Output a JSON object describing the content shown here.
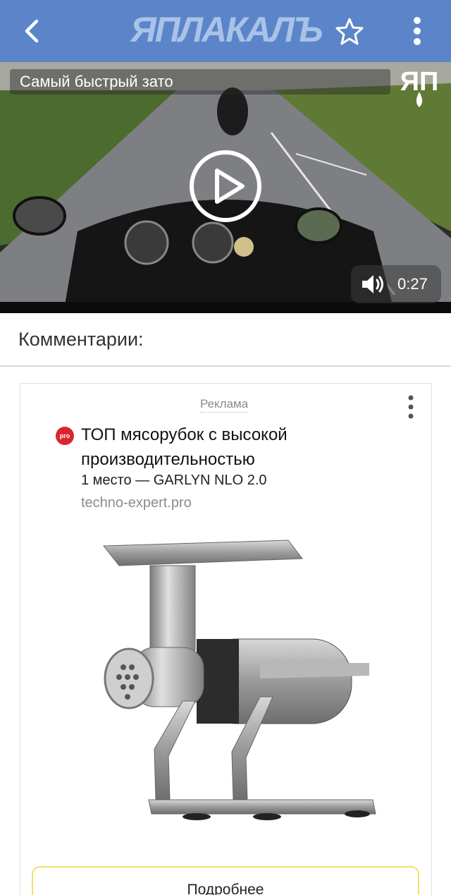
{
  "header": {
    "logo_text": "ЯПЛАКАЛЪ",
    "back_icon": "back-arrow-icon",
    "star_icon": "star-outline-icon",
    "more_icon": "more-vertical-icon",
    "color": "#5b85c8"
  },
  "video": {
    "title": "Самый быстрый зато",
    "watermark": "ЯП",
    "duration": "0:27",
    "play_icon": "play-icon",
    "volume_icon": "volume-icon"
  },
  "comments": {
    "title": "Комментарии:"
  },
  "ad": {
    "label": "Реклама",
    "favicon_text": "pro",
    "headline": "ТОП мясорубок с высокой производительностью",
    "subtitle": "1 место — GARLYN NLO 2.0",
    "domain": "techno-expert.pro",
    "button_label": "Подробнее",
    "button_border_color": "#f2e066"
  }
}
